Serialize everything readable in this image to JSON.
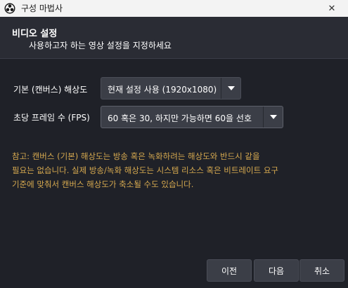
{
  "window": {
    "title": "구성 마법사",
    "close_glyph": "✕"
  },
  "header": {
    "title": "비디오 설정",
    "subtitle": "사용하고자 하는 영상 설정을 지정하세요"
  },
  "form": {
    "base_resolution": {
      "label": "기본 (캔버스) 해상도",
      "value": "현재 설정 사용 (1920x1080)"
    },
    "fps": {
      "label": "초당 프레임 수 (FPS)",
      "value": "60 혹은 30, 하지만 가능하면 60을 선호"
    }
  },
  "note": {
    "line1": "참고: 캔버스 (기본) 해상도는 방송 혹은 녹화하려는 해상도와 반드시 같을",
    "line2": "필요는 없습니다. 실제 방송/녹화 해상도는 시스템 리소스 혹은 비트레이트 요구",
    "line3": "기준에 맞춰서 캔버스 해상도가 축소될 수도 있습니다."
  },
  "buttons": {
    "back": "이전",
    "next": "다음",
    "cancel": "취소"
  },
  "icons": {
    "app": "obs-logo-icon",
    "dropdown": "chevron-down-icon",
    "close": "close-icon"
  },
  "colors": {
    "background": "#1f2128",
    "header_bg": "#2a2c34",
    "control_bg": "#3b3e47",
    "note_text": "#d6a94f",
    "titlebar_bg": "#f3f3f3"
  }
}
